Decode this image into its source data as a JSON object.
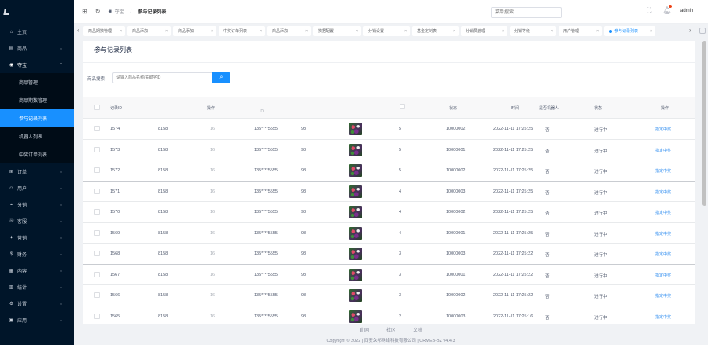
{
  "sidebar": {
    "items": [
      {
        "label": "主页",
        "icon": "home-icon",
        "glyph": "⌂"
      },
      {
        "label": "商品",
        "icon": "shop-icon",
        "glyph": "▤",
        "chevron": "⌄"
      },
      {
        "label": "夺宝",
        "icon": "target-icon",
        "glyph": "◉",
        "chevron": "⌃",
        "open": true
      },
      {
        "label": "订单",
        "icon": "cart-icon",
        "glyph": "⊞",
        "chevron": "⌄"
      },
      {
        "label": "用户",
        "icon": "user-icon",
        "glyph": "☺",
        "chevron": "⌄"
      },
      {
        "label": "分销",
        "icon": "share-icon",
        "glyph": "⚭",
        "chevron": "⌄"
      },
      {
        "label": "客服",
        "icon": "service-icon",
        "glyph": "☏",
        "chevron": "⌄"
      },
      {
        "label": "营销",
        "icon": "marketing-icon",
        "glyph": "✦",
        "chevron": "⌄"
      },
      {
        "label": "财务",
        "icon": "finance-icon",
        "glyph": "$",
        "chevron": "⌄"
      },
      {
        "label": "内容",
        "icon": "content-icon",
        "glyph": "▦",
        "chevron": "⌄"
      },
      {
        "label": "统计",
        "icon": "stats-icon",
        "glyph": "▥",
        "chevron": "⌄"
      },
      {
        "label": "设置",
        "icon": "gear-icon",
        "glyph": "⚙",
        "chevron": "⌄"
      },
      {
        "label": "应用",
        "icon": "app-icon",
        "glyph": "▣",
        "chevron": "⌄"
      }
    ],
    "sub_items": [
      {
        "label": "商品管理",
        "active": false
      },
      {
        "label": "商品期数管理",
        "active": false
      },
      {
        "label": "参与记录列表",
        "active": true
      },
      {
        "label": "机器人列表",
        "active": false
      },
      {
        "label": "中奖订单列表",
        "active": false
      }
    ]
  },
  "header": {
    "crumb_root": "夺宝",
    "crumb_current": "参与记录列表",
    "search_placeholder": "菜单搜索",
    "user": "admin"
  },
  "tabs": [
    {
      "label": "商品期数管理",
      "x": 0
    },
    {
      "label": "商品添加",
      "x": 0
    },
    {
      "label": "商品添加",
      "x": 0
    },
    {
      "label": "中奖订单列表",
      "x": 0
    },
    {
      "label": "商品添加",
      "x": 0
    },
    {
      "label": "数据配置",
      "x": 0
    },
    {
      "label": "分销设置",
      "x": 0
    },
    {
      "label": "基金定制表",
      "x": 0
    },
    {
      "label": "分销员管理",
      "x": 0
    },
    {
      "label": "分销等级",
      "x": 0
    },
    {
      "label": "用户管理",
      "x": 0
    },
    {
      "label": "参与记录列表",
      "x": 0,
      "active": true
    }
  ],
  "page": {
    "title": "参与记录列表",
    "filter_label": "商品搜索:",
    "filter_placeholder": "请输入商品名称/关键字ID"
  },
  "table": {
    "headers": {
      "id": "记录ID",
      "op": "操作",
      "col3": "ID",
      "status_w": "状态",
      "time": "时间",
      "is_robot": "是否机器人",
      "state": "状态",
      "action": "操作"
    },
    "rows": [
      {
        "id": "1574",
        "goods": "8158",
        "f": "16",
        "phone": "135****5555",
        "n": "98",
        "qty": "5",
        "code": "10000002",
        "time": "2022-11-11 17:25:25",
        "robot": "否",
        "state": "进行中",
        "action": "指定中奖"
      },
      {
        "id": "1573",
        "goods": "8158",
        "f": "16",
        "phone": "135****5555",
        "n": "98",
        "qty": "5",
        "code": "10000001",
        "time": "2022-11-11 17:25:25",
        "robot": "否",
        "state": "进行中",
        "action": "指定中奖"
      },
      {
        "id": "1572",
        "goods": "8158",
        "f": "16",
        "phone": "135****5555",
        "n": "98",
        "qty": "5",
        "code": "10000002",
        "time": "2022-11-11 17:25:25",
        "robot": "否",
        "state": "进行中",
        "action": "指定中奖"
      },
      {
        "id": "1571",
        "goods": "8158",
        "f": "16",
        "phone": "135****5555",
        "n": "98",
        "qty": "4",
        "code": "10000003",
        "time": "2022-11-11 17:25:25",
        "robot": "否",
        "state": "进行中",
        "action": "指定中奖"
      },
      {
        "id": "1570",
        "goods": "8158",
        "f": "16",
        "phone": "135****5555",
        "n": "98",
        "qty": "4",
        "code": "10000002",
        "time": "2022-11-11 17:25:25",
        "robot": "否",
        "state": "进行中",
        "action": "指定中奖"
      },
      {
        "id": "1569",
        "goods": "8158",
        "f": "16",
        "phone": "135****5555",
        "n": "98",
        "qty": "4",
        "code": "10000001",
        "time": "2022-11-11 17:25:25",
        "robot": "否",
        "state": "进行中",
        "action": "指定中奖"
      },
      {
        "id": "1568",
        "goods": "8158",
        "f": "16",
        "phone": "135****5555",
        "n": "98",
        "qty": "3",
        "code": "10000003",
        "time": "2022-11-11 17:25:22",
        "robot": "否",
        "state": "进行中",
        "action": "指定中奖"
      },
      {
        "id": "1567",
        "goods": "8158",
        "f": "16",
        "phone": "135****5555",
        "n": "98",
        "qty": "3",
        "code": "10000001",
        "time": "2022-11-11 17:25:22",
        "robot": "否",
        "state": "进行中",
        "action": "指定中奖"
      },
      {
        "id": "1566",
        "goods": "8158",
        "f": "16",
        "phone": "135****5555",
        "n": "98",
        "qty": "3",
        "code": "10000002",
        "time": "2022-11-11 17:25:22",
        "robot": "否",
        "state": "进行中",
        "action": "指定中奖"
      },
      {
        "id": "1565",
        "goods": "8158",
        "f": "16",
        "phone": "135****5555",
        "n": "98",
        "qty": "2",
        "code": "10000003",
        "time": "2022-11-11 17:25:16",
        "robot": "否",
        "state": "进行中",
        "action": "指定中奖"
      }
    ]
  },
  "footer": {
    "links": [
      "官网",
      "社区",
      "文档"
    ],
    "copyright": "Copyright © 2022 | 西安众邦网络科技有限公司 | CRMEB-BZ v4.4.3"
  }
}
